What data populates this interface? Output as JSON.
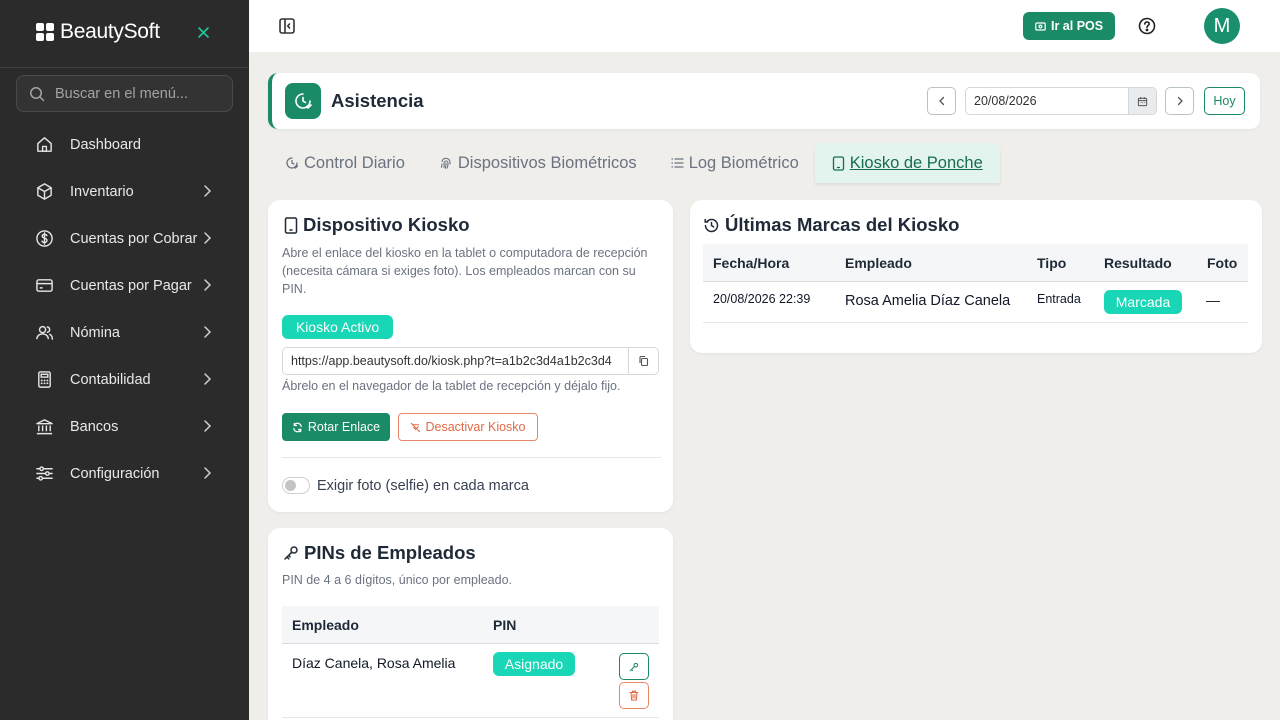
{
  "sidebar": {
    "brand": "BeautySoft",
    "search_placeholder": "Buscar en el menú...",
    "items": [
      {
        "label": "Dashboard",
        "icon": "home-icon",
        "has_children": false
      },
      {
        "label": "Inventario",
        "icon": "box-icon",
        "has_children": true
      },
      {
        "label": "Cuentas por Cobrar",
        "icon": "dollar-icon",
        "has_children": true
      },
      {
        "label": "Cuentas por Pagar",
        "icon": "card-icon",
        "has_children": true
      },
      {
        "label": "Nómina",
        "icon": "users-icon",
        "has_children": true
      },
      {
        "label": "Contabilidad",
        "icon": "calculator-icon",
        "has_children": true
      },
      {
        "label": "Bancos",
        "icon": "bank-icon",
        "has_children": true
      },
      {
        "label": "Configuración",
        "icon": "sliders-icon",
        "has_children": true
      }
    ]
  },
  "topbar": {
    "pos_label": "Ir al POS",
    "avatar_initial": "M"
  },
  "header": {
    "title": "Asistencia",
    "date": "20/08/2026",
    "today_label": "Hoy"
  },
  "tabs": [
    {
      "label": "Control Diario",
      "icon": "clock-icon",
      "active": false
    },
    {
      "label": "Dispositivos Biométricos",
      "icon": "fingerprint-icon",
      "active": false
    },
    {
      "label": "Log Biométrico",
      "icon": "list-icon",
      "active": false
    },
    {
      "label": "Kiosko de Ponche",
      "icon": "tablet-icon",
      "active": true
    }
  ],
  "kiosk": {
    "title": "Dispositivo Kiosko",
    "description": "Abre el enlace del kiosko en la tablet o computadora de recepción (necesita cámara si exiges foto). Los empleados marcan con su PIN.",
    "status_badge": "Kiosko Activo",
    "link": "https://app.beautysoft.do/kiosk.php?t=a1b2c3d4a1b2c3d4",
    "hint": "Ábrelo en el navegador de la tablet de recepción y déjalo fijo.",
    "rotate_label": "Rotar Enlace",
    "deactivate_label": "Desactivar Kiosko",
    "selfie_label": "Exigir foto (selfie) en cada marca",
    "selfie_enabled": false
  },
  "pins": {
    "title": "PINs de Empleados",
    "description": "PIN de 4 a 6 dígitos, único por empleado.",
    "columns": [
      "Empleado",
      "PIN"
    ],
    "rows": [
      {
        "employee": "Díaz Canela, Rosa Amelia",
        "pin_status": "Asignado"
      }
    ]
  },
  "marks": {
    "title": "Últimas Marcas del Kiosko",
    "columns": [
      "Fecha/Hora",
      "Empleado",
      "Tipo",
      "Resultado",
      "Foto"
    ],
    "rows": [
      {
        "datetime": "20/08/2026 22:39",
        "employee": "Rosa Amelia Díaz Canela",
        "type": "Entrada",
        "result": "Marcada",
        "photo": "—"
      }
    ]
  },
  "colors": {
    "sidebar_bg": "#2b2b2b",
    "primary": "#1b8a66",
    "badge": "#19d6b6",
    "danger": "#e06a47",
    "page_bg": "#efeeeb"
  }
}
